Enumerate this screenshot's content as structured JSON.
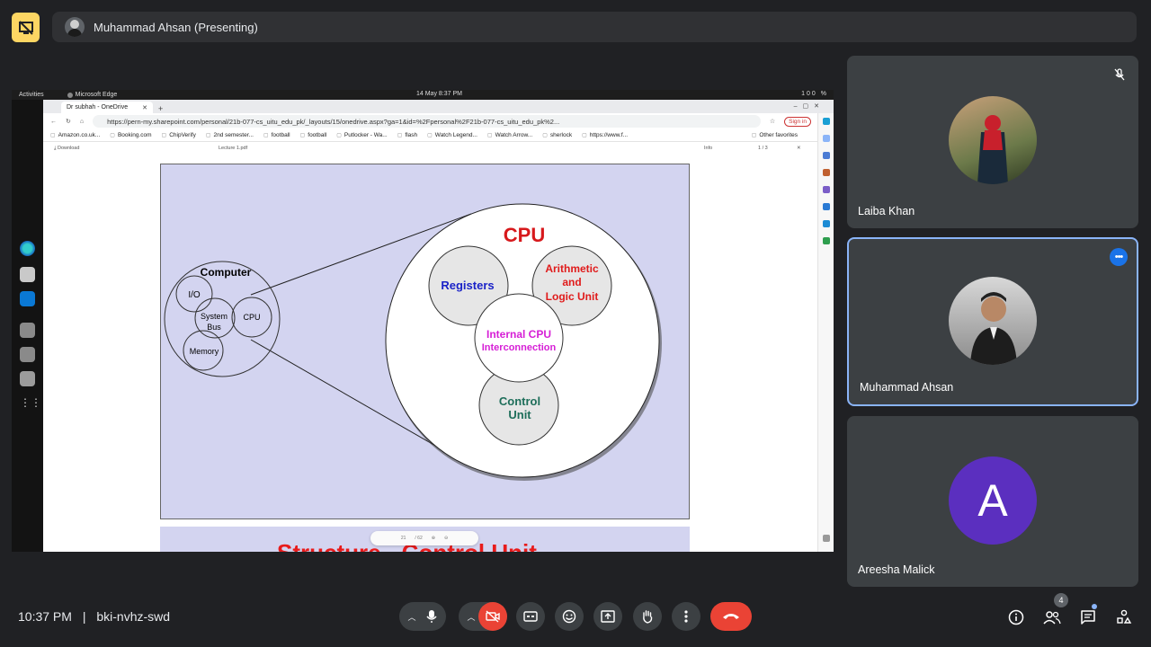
{
  "presenting": {
    "label": "Muhammad Ahsan (Presenting)"
  },
  "desktop": {
    "activities": "Activities",
    "app_name": "Microsoft Edge",
    "clock": "14 May  8:37 PM",
    "tray_battery": "100 %"
  },
  "browser": {
    "tab_title": "Dr subhah - OneDrive",
    "url": "https://pern-my.sharepoint.com/personal/21b-077-cs_uitu_edu_pk/_layouts/15/onedrive.aspx?ga=1&id=%2Fpersonal%2F21b-077-cs_uitu_edu_pk%2...",
    "signin": "Sign in",
    "bookmarks": [
      "Amazon.co.uk...",
      "Booking.com",
      "ChipVerify",
      "2nd semester...",
      "football",
      "football",
      "Putlocker - Wa...",
      "flash",
      "Watch Legend...",
      "Watch Arrow...",
      "sherlock",
      "https://www.f..."
    ],
    "other_favorites": "Other favorites",
    "pdf_download": "Download",
    "pdf_filename": "Lecture 1.pdf",
    "pdf_info": "Info",
    "pdf_pages": "1 / 3",
    "zoom_page": "21",
    "zoom_total": "/ 62"
  },
  "slide": {
    "computer": {
      "title": "Computer",
      "io": "I/O",
      "system_bus_1": "System",
      "system_bus_2": "Bus",
      "cpu": "CPU",
      "memory": "Memory"
    },
    "cpu": {
      "title": "CPU",
      "registers": "Registers",
      "alu_1": "Arithmetic",
      "alu_2": "and",
      "alu_3": "Logic Unit",
      "internal_1": "Internal CPU",
      "internal_2": "Interconnection",
      "control_1": "Control",
      "control_2": "Unit"
    },
    "next_title": "Structure - Control Unit",
    "colors": {
      "background": "#d3d4f0",
      "cpu_title": "#d7191c",
      "registers": "#1a22c8",
      "alu": "#e01b1b",
      "internal": "#d61fd6",
      "control": "#1e6e5a"
    }
  },
  "participants": [
    {
      "name": "Laiba Khan",
      "muted": true
    },
    {
      "name": "Muhammad Ahsan",
      "active": true
    },
    {
      "name": "Areesha Malick",
      "initial": "A"
    }
  ],
  "bottom": {
    "time": "10:37 PM",
    "meeting_code": "bki-nvhz-swd",
    "separator": "|",
    "people_count": "4"
  }
}
